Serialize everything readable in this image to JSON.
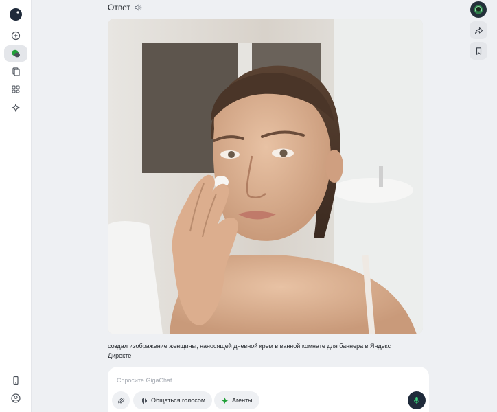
{
  "header": {
    "title": "Ответ"
  },
  "sidebar": {
    "items": [
      {
        "name": "logo",
        "icon": "gigachat-logo-icon"
      },
      {
        "name": "new-chat",
        "icon": "plus-chat-icon"
      },
      {
        "name": "chats",
        "icon": "chat-bubbles-icon",
        "active": true
      },
      {
        "name": "files",
        "icon": "files-icon"
      },
      {
        "name": "apps",
        "icon": "apps-grid-icon"
      },
      {
        "name": "sparkle",
        "icon": "sparkle-icon"
      },
      {
        "name": "mobile",
        "icon": "phone-icon"
      },
      {
        "name": "profile",
        "icon": "user-circle-icon"
      }
    ]
  },
  "right_rail": {
    "avatar_icon": "assistant-avatar-icon",
    "share_icon": "share-icon",
    "bookmark_icon": "bookmark-icon"
  },
  "message": {
    "image_icon": "generated-image",
    "caption": "создал изображение женщины, наносящей дневной крем в ванной комнате для баннера в Яндекс Директе."
  },
  "composer": {
    "placeholder": "Спросите GigaChat",
    "value": "",
    "voice_label": "Общаться голосом",
    "agents_label": "Агенты"
  },
  "colors": {
    "accent": "#21a038",
    "background": "#eef0f3",
    "dark_button": "#1f2a3a"
  }
}
